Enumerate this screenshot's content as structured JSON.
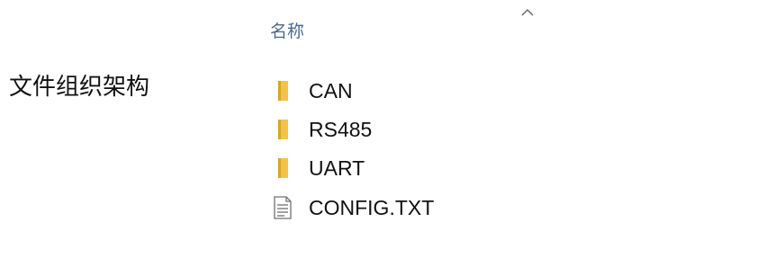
{
  "side_label": "文件组织架构",
  "header": {
    "column_name": "名称",
    "sort_indicator": "chevron-up-icon"
  },
  "files": [
    {
      "name": "CAN",
      "type": "folder",
      "icon": "folder-icon"
    },
    {
      "name": "RS485",
      "type": "folder",
      "icon": "folder-icon"
    },
    {
      "name": "UART",
      "type": "folder",
      "icon": "folder-icon"
    },
    {
      "name": "CONFIG.TXT",
      "type": "text-file",
      "icon": "text-file-icon"
    }
  ],
  "colors": {
    "folder_yellow": "#f3c24b",
    "folder_dark": "#d9a521",
    "header_text": "#4d6a8a",
    "file_icon_stroke": "#707070"
  }
}
